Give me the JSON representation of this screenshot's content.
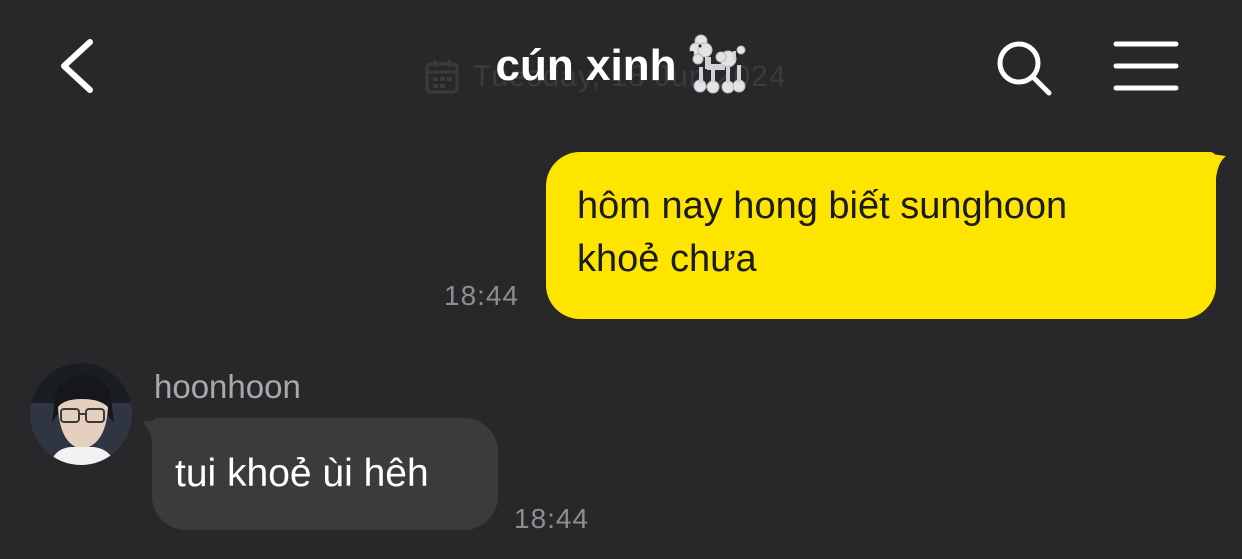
{
  "header": {
    "back_icon": "chevron-left-icon",
    "title": "cún xinh",
    "title_emoji": "poodle-emoji",
    "date_text": "Tuesday, 18 Jun 2024",
    "calendar_icon": "calendar-icon",
    "search_icon": "search-icon",
    "menu_icon": "hamburger-menu-icon"
  },
  "messages": [
    {
      "direction": "sent",
      "lines": [
        "hôm nay hong biết sunghoon",
        "khoẻ chưa"
      ],
      "time": "18:44"
    },
    {
      "direction": "received",
      "sender": "hoonhoon",
      "text": "tui khoẻ ùi hêh",
      "time": "18:44"
    }
  ],
  "colors": {
    "background": "#28282a",
    "sent_bubble": "#fde500",
    "received_bubble": "#3b3b3d",
    "timestamp": "#8e8e92",
    "sender_name": "#a9a9ad"
  }
}
